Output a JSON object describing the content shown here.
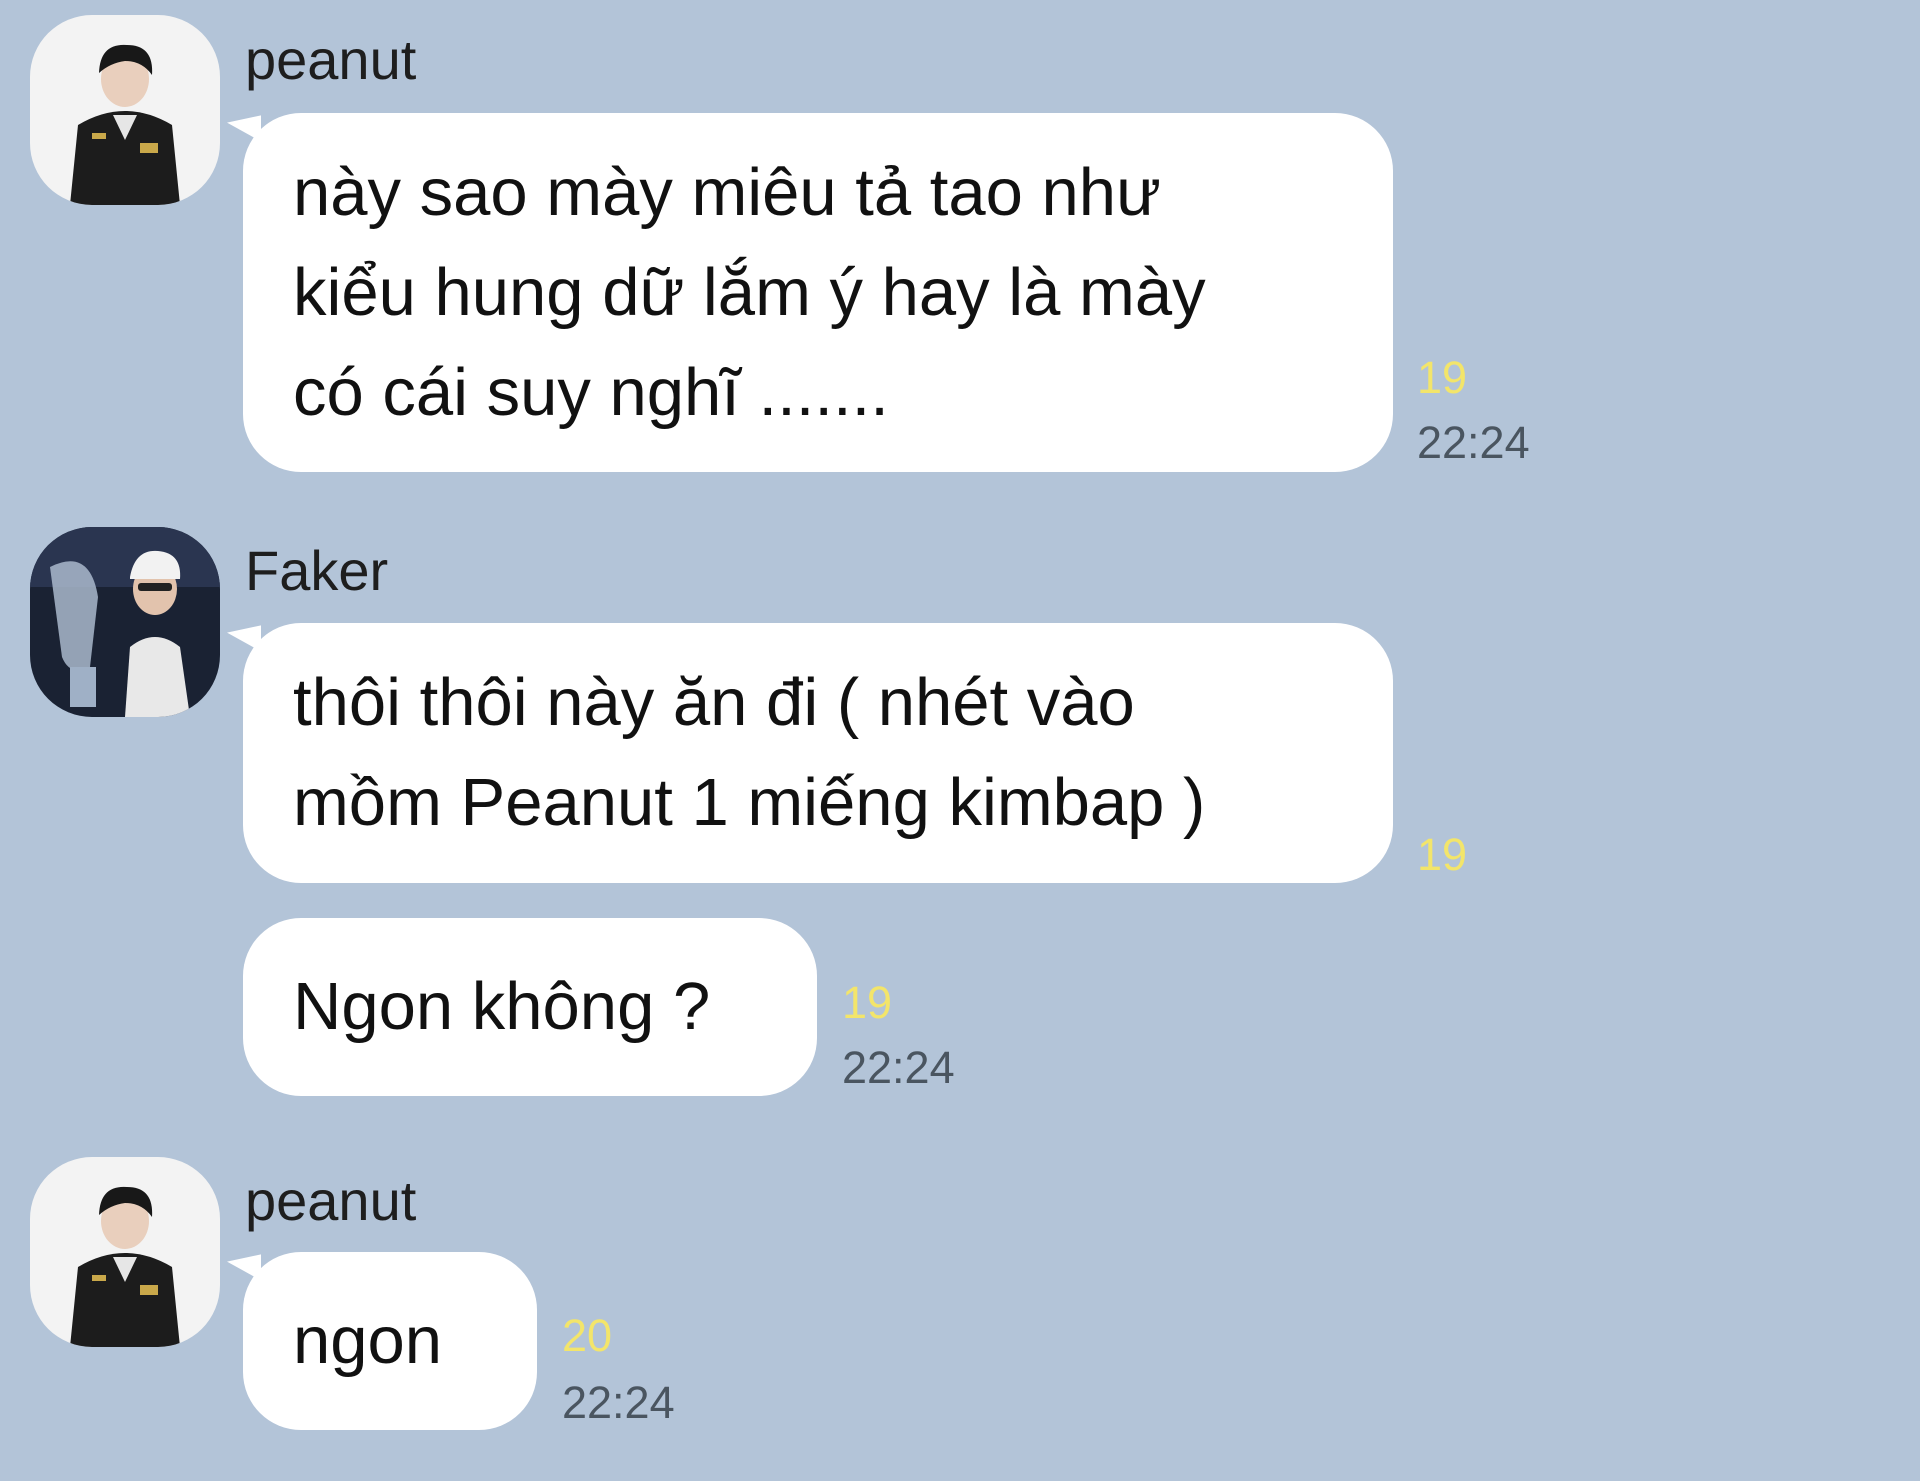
{
  "conversation": {
    "groups": [
      {
        "sender": "peanut",
        "avatar": "peanut-avatar",
        "messages": [
          {
            "lines": [
              "này sao mày miêu tả tao như",
              "kiểu hung dữ lắm ý hay là mày",
              "có cái suy nghĩ ......."
            ],
            "unread": "19",
            "time": "22:24"
          }
        ]
      },
      {
        "sender": "Faker",
        "avatar": "faker-avatar",
        "messages": [
          {
            "lines": [
              "thôi thôi này ăn đi ( nhét vào",
              "mồm Peanut 1 miếng kimbap )"
            ],
            "unread": "19",
            "time": ""
          },
          {
            "lines": [
              "Ngon không ?"
            ],
            "unread": "19",
            "time": "22:24"
          }
        ]
      },
      {
        "sender": "peanut",
        "avatar": "peanut-avatar",
        "messages": [
          {
            "lines": [
              "ngon"
            ],
            "unread": "20",
            "time": "22:24"
          }
        ]
      }
    ]
  },
  "colors": {
    "background": "#b3c4d8",
    "bubble": "#ffffff",
    "unread": "#f3e56a",
    "time": "#4a5560"
  }
}
